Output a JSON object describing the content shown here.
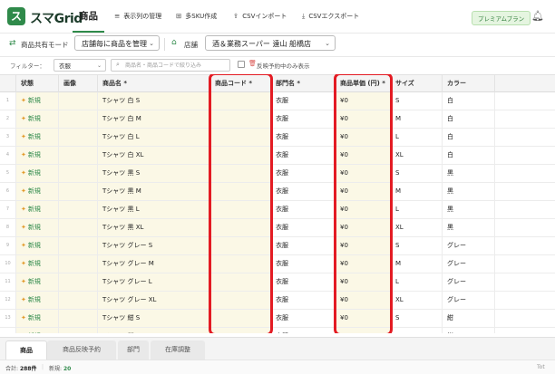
{
  "app": {
    "logo_text": "ス",
    "name": "スマGrid"
  },
  "nav": {
    "active": "商品",
    "items": [
      {
        "icon": "≡",
        "label": "表示列の管理"
      },
      {
        "icon": "⊞",
        "label": "多SKU作成"
      },
      {
        "icon": "⇪",
        "label": "CSVインポート"
      },
      {
        "icon": "⤓",
        "label": "CSVエクスポート"
      }
    ],
    "premium": "プレミアムプラン"
  },
  "modebar": {
    "mode_label": "商品共有モード",
    "mode_value": "店舗毎に商品を管理",
    "store_label": "店舗",
    "store_value": "酒＆業務スーパー 遠山 船橋店"
  },
  "filter": {
    "label": "フィルター：",
    "select_value": "衣服",
    "search_placeholder": "商品名・商品コードで絞り込み",
    "checkbox_label": "反映予約中のみ表示"
  },
  "table": {
    "columns": [
      "状態",
      "画像",
      "商品名 *",
      "商品コード *",
      "部門名 *",
      "商品単価 (円) *",
      "サイズ",
      "カラー"
    ],
    "rows": [
      {
        "num": "1",
        "status": "新規",
        "name": "Tシャツ 白 S",
        "code": "",
        "dept": "衣服",
        "price": "¥0",
        "size": "S",
        "color": "白"
      },
      {
        "num": "2",
        "status": "新規",
        "name": "Tシャツ 白 M",
        "code": "",
        "dept": "衣服",
        "price": "¥0",
        "size": "M",
        "color": "白"
      },
      {
        "num": "3",
        "status": "新規",
        "name": "Tシャツ 白 L",
        "code": "",
        "dept": "衣服",
        "price": "¥0",
        "size": "L",
        "color": "白"
      },
      {
        "num": "4",
        "status": "新規",
        "name": "Tシャツ 白 XL",
        "code": "",
        "dept": "衣服",
        "price": "¥0",
        "size": "XL",
        "color": "白"
      },
      {
        "num": "5",
        "status": "新規",
        "name": "Tシャツ 黒 S",
        "code": "",
        "dept": "衣服",
        "price": "¥0",
        "size": "S",
        "color": "黒"
      },
      {
        "num": "6",
        "status": "新規",
        "name": "Tシャツ 黒 M",
        "code": "",
        "dept": "衣服",
        "price": "¥0",
        "size": "M",
        "color": "黒"
      },
      {
        "num": "7",
        "status": "新規",
        "name": "Tシャツ 黒 L",
        "code": "",
        "dept": "衣服",
        "price": "¥0",
        "size": "L",
        "color": "黒"
      },
      {
        "num": "8",
        "status": "新規",
        "name": "Tシャツ 黒 XL",
        "code": "",
        "dept": "衣服",
        "price": "¥0",
        "size": "XL",
        "color": "黒"
      },
      {
        "num": "9",
        "status": "新規",
        "name": "Tシャツ グレー S",
        "code": "",
        "dept": "衣服",
        "price": "¥0",
        "size": "S",
        "color": "グレー"
      },
      {
        "num": "10",
        "status": "新規",
        "name": "Tシャツ グレー M",
        "code": "",
        "dept": "衣服",
        "price": "¥0",
        "size": "M",
        "color": "グレー"
      },
      {
        "num": "11",
        "status": "新規",
        "name": "Tシャツ グレー L",
        "code": "",
        "dept": "衣服",
        "price": "¥0",
        "size": "L",
        "color": "グレー"
      },
      {
        "num": "12",
        "status": "新規",
        "name": "Tシャツ グレー XL",
        "code": "",
        "dept": "衣服",
        "price": "¥0",
        "size": "XL",
        "color": "グレー"
      },
      {
        "num": "13",
        "status": "新規",
        "name": "Tシャツ 紺 S",
        "code": "",
        "dept": "衣服",
        "price": "¥0",
        "size": "S",
        "color": "紺"
      },
      {
        "num": "14",
        "status": "新規",
        "name": "Tシャツ 紺 M",
        "code": "",
        "dept": "衣服",
        "price": "¥0",
        "size": "M",
        "color": "紺"
      }
    ]
  },
  "tabs": [
    "商品",
    "商品反映予約",
    "部門",
    "在庫調整"
  ],
  "status_bar": {
    "total_label": "合計:",
    "total_value": "288件",
    "new_label": "新規:",
    "new_value": "20",
    "right": "Tot"
  },
  "colors": {
    "accent": "#2f8a4a",
    "highlight": "#e31b23",
    "editable_cell": "#fbf8e6"
  }
}
